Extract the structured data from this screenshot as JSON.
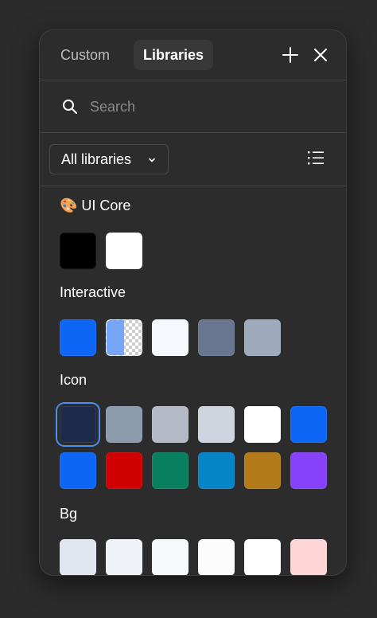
{
  "tabs": {
    "custom": "Custom",
    "libraries": "Libraries"
  },
  "search": {
    "placeholder": "Search",
    "value": ""
  },
  "filter": {
    "selected": "All libraries"
  },
  "icons": {
    "add": "plus-icon",
    "close": "close-icon",
    "search": "search-icon",
    "dropdown": "chevron-down-icon",
    "view": "list-view-icon"
  },
  "sections": [
    {
      "title": "🎨 UI Core",
      "swatches": [
        "#000000",
        "#ffffff"
      ]
    },
    {
      "title": "Interactive",
      "swatches": [
        "#0d66f5",
        "half:#78a6f7",
        "#f5f8fd",
        "#68778f",
        "#9eabbd"
      ]
    },
    {
      "title": "Icon",
      "swatches": [
        "#1e2a4a",
        "#8c9aae",
        "#b5b9c5",
        "#cfd4de",
        "#ffffff",
        "#0d66f5",
        "#0d66f5",
        "#d00000",
        "#088060",
        "#0584c7",
        "#b37a1a",
        "#8542f9"
      ],
      "selected_index": 0
    },
    {
      "title": "Bg",
      "swatches": [
        "#e1e5ee",
        "#eff2f6",
        "#f7f8fb",
        "#fcfcfd",
        "#ffffff",
        "#ffd6d6"
      ]
    }
  ],
  "colors": {
    "panel": "#2c2c2c",
    "accent": "#4d8ff0",
    "divider": "#444444"
  }
}
